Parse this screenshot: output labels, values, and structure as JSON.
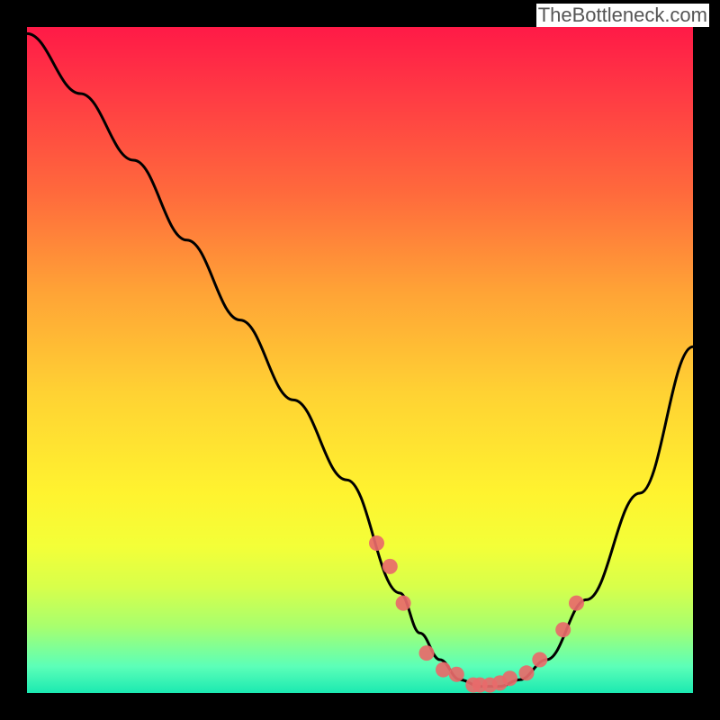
{
  "attribution": "TheBottleneck.com",
  "chart_data": {
    "type": "line",
    "title": "",
    "xlabel": "",
    "ylabel": "",
    "xlim": [
      0,
      100
    ],
    "ylim": [
      0,
      100
    ],
    "series": [
      {
        "name": "bottleneck-curve",
        "x": [
          0,
          8,
          16,
          24,
          32,
          40,
          48,
          56,
          59,
          62,
          65,
          68,
          71,
          74,
          78,
          84,
          92,
          100
        ],
        "y": [
          99,
          90,
          80,
          68,
          56,
          44,
          32,
          15,
          9,
          5,
          2,
          1,
          1,
          2,
          5,
          14,
          30,
          52
        ]
      }
    ],
    "markers": {
      "name": "highlight-points",
      "x": [
        52.5,
        54.5,
        56.5,
        60.0,
        62.5,
        64.5,
        67.0,
        68.0,
        69.5,
        71.0,
        72.5,
        75.0,
        77.0,
        80.5,
        82.5
      ],
      "y": [
        22.5,
        19.0,
        13.5,
        6.0,
        3.5,
        2.8,
        1.2,
        1.2,
        1.2,
        1.5,
        2.2,
        3.0,
        5.0,
        9.5,
        13.5
      ]
    },
    "gradient_stops": [
      {
        "pos": 0.0,
        "color": "#ff1a47"
      },
      {
        "pos": 0.1,
        "color": "#ff3a44"
      },
      {
        "pos": 0.25,
        "color": "#ff6a3c"
      },
      {
        "pos": 0.4,
        "color": "#ffa436"
      },
      {
        "pos": 0.55,
        "color": "#ffd233"
      },
      {
        "pos": 0.7,
        "color": "#fff32f"
      },
      {
        "pos": 0.78,
        "color": "#f3ff38"
      },
      {
        "pos": 0.84,
        "color": "#d8ff4a"
      },
      {
        "pos": 0.9,
        "color": "#a8ff6e"
      },
      {
        "pos": 0.96,
        "color": "#5cffb8"
      },
      {
        "pos": 1.0,
        "color": "#1be9b1"
      }
    ]
  }
}
